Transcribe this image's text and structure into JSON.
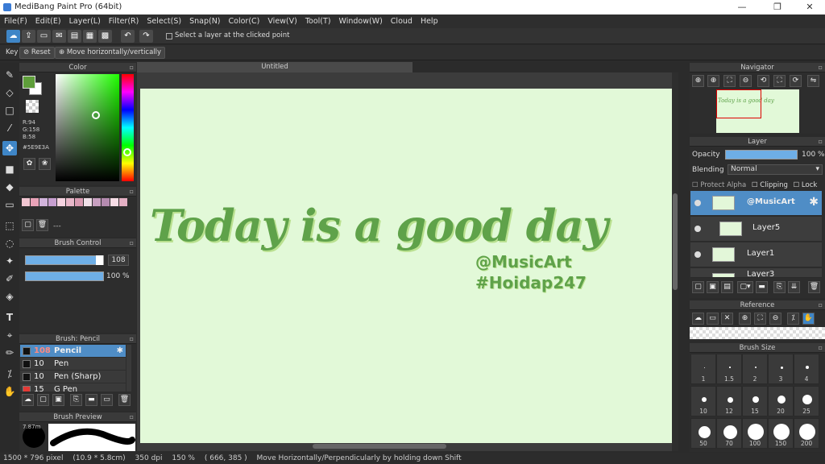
{
  "window": {
    "title": "MediBang Paint Pro (64bit)",
    "min": "—",
    "max": "❐",
    "close": "✕"
  },
  "menu": [
    "File(F)",
    "Edit(E)",
    "Layer(L)",
    "Filter(R)",
    "Select(S)",
    "Snap(N)",
    "Color(C)",
    "View(V)",
    "Tool(T)",
    "Window(W)",
    "Cloud",
    "Help"
  ],
  "toolbar": {
    "select_layer_label": "Select a layer at the clicked point"
  },
  "options": {
    "key": "Key",
    "reset": "Reset",
    "move": "Move horizontally/vertically"
  },
  "color": {
    "title": "Color",
    "r": "R:94",
    "g": "G:158",
    "b": "B:58",
    "hex": "#5E9E3A",
    "main": "#5e9e3a"
  },
  "palette": {
    "title": "Palette",
    "swatches": [
      "#f2c6d2",
      "#e9a3b8",
      "#d2b4dc",
      "#c79fd0",
      "#f5d3e0",
      "#e8b7c9",
      "#d99bb2",
      "#f0e0e8",
      "#c8a0c0",
      "#b58bb0",
      "#f7dde6",
      "#e4b0c4"
    ]
  },
  "brush_control": {
    "title": "Brush Control",
    "size": "108",
    "opacity": "100 %"
  },
  "brushes": {
    "title": "Brush: Pencil",
    "items": [
      {
        "size": "108",
        "name": "Pencil",
        "selected": true
      },
      {
        "size": "10",
        "name": "Pen",
        "selected": false
      },
      {
        "size": "10",
        "name": "Pen (Sharp)",
        "selected": false
      },
      {
        "size": "15",
        "name": "G Pen",
        "selected": false
      }
    ]
  },
  "brush_preview": {
    "title": "Brush Preview",
    "value": "7.87m"
  },
  "document": {
    "tab": "Untitled",
    "line1": "Today is a good day",
    "line2": "@MusicArt",
    "line3": "#Hoidap247"
  },
  "navigator": {
    "title": "Navigator",
    "thumb_text": "Today is a good day"
  },
  "layer": {
    "title": "Layer",
    "opacity_label": "Opacity",
    "opacity": "100 %",
    "blending_label": "Blending",
    "blending": "Normal",
    "protect": "Protect Alpha",
    "clipping": "Clipping",
    "lock": "Lock",
    "items": [
      {
        "name": "@MusicArt",
        "selected": true
      },
      {
        "name": "Layer5",
        "selected": false
      },
      {
        "name": "Layer1",
        "selected": false
      },
      {
        "name": "Layer3",
        "selected": false
      }
    ]
  },
  "reference": {
    "title": "Reference"
  },
  "brush_size": {
    "title": "Brush Size",
    "sizes": [
      "1",
      "1.5",
      "2",
      "3",
      "4",
      "10",
      "12",
      "15",
      "20",
      "25",
      "50",
      "70",
      "100",
      "150",
      "200"
    ]
  },
  "status": {
    "pixels": "1500 * 796 pixel",
    "cm": "(10.9 * 5.8cm)",
    "dpi": "350 dpi",
    "zoom": "150 %",
    "coords": "( 666, 385 )",
    "hint": "Move Horizontally/Perpendicularly by holding down Shift"
  }
}
